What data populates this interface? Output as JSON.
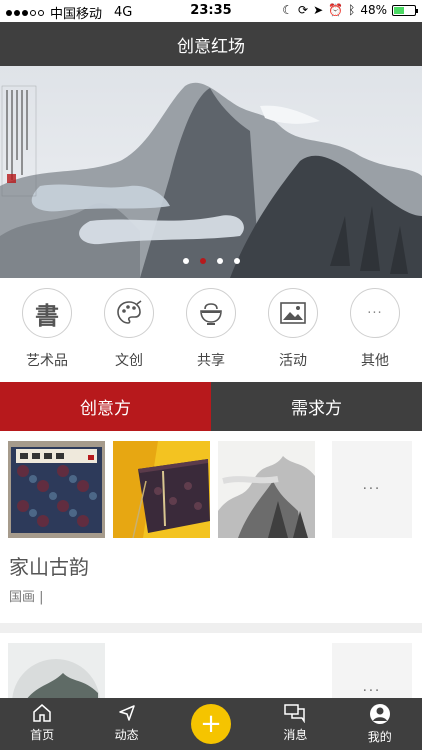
{
  "status_bar": {
    "carrier": "中国移动",
    "network": "4G",
    "time": "23:35",
    "battery": "48%",
    "battery_level": 0.48
  },
  "header": {
    "title": "创意红场"
  },
  "banner": {
    "slide_count": 4,
    "active_index": 1
  },
  "categories": [
    {
      "label": "艺术品",
      "icon": "calligraphy-icon",
      "glyph": "書"
    },
    {
      "label": "文创",
      "icon": "palette-icon",
      "glyph": ""
    },
    {
      "label": "共享",
      "icon": "bowl-icon",
      "glyph": ""
    },
    {
      "label": "活动",
      "icon": "picture-icon",
      "glyph": ""
    },
    {
      "label": "其他",
      "icon": "more-icon",
      "glyph": "···"
    }
  ],
  "tabs": [
    {
      "label": "创意方",
      "active": true
    },
    {
      "label": "需求方",
      "active": false
    }
  ],
  "listings": [
    {
      "title": "家山古韵",
      "tag": "国画 |",
      "more": "···"
    },
    {
      "title": "",
      "tag": "",
      "more": "···"
    }
  ],
  "bottom_nav": [
    {
      "label": "首页",
      "icon": "home-icon"
    },
    {
      "label": "动态",
      "icon": "navigation-icon"
    },
    {
      "label": "",
      "icon": "add-icon"
    },
    {
      "label": "消息",
      "icon": "message-icon"
    },
    {
      "label": "我的",
      "icon": "profile-icon"
    }
  ],
  "colors": {
    "primary_red": "#b7191c",
    "dark_bar": "#3f3f3f",
    "accent_yellow": "#f5c400"
  }
}
